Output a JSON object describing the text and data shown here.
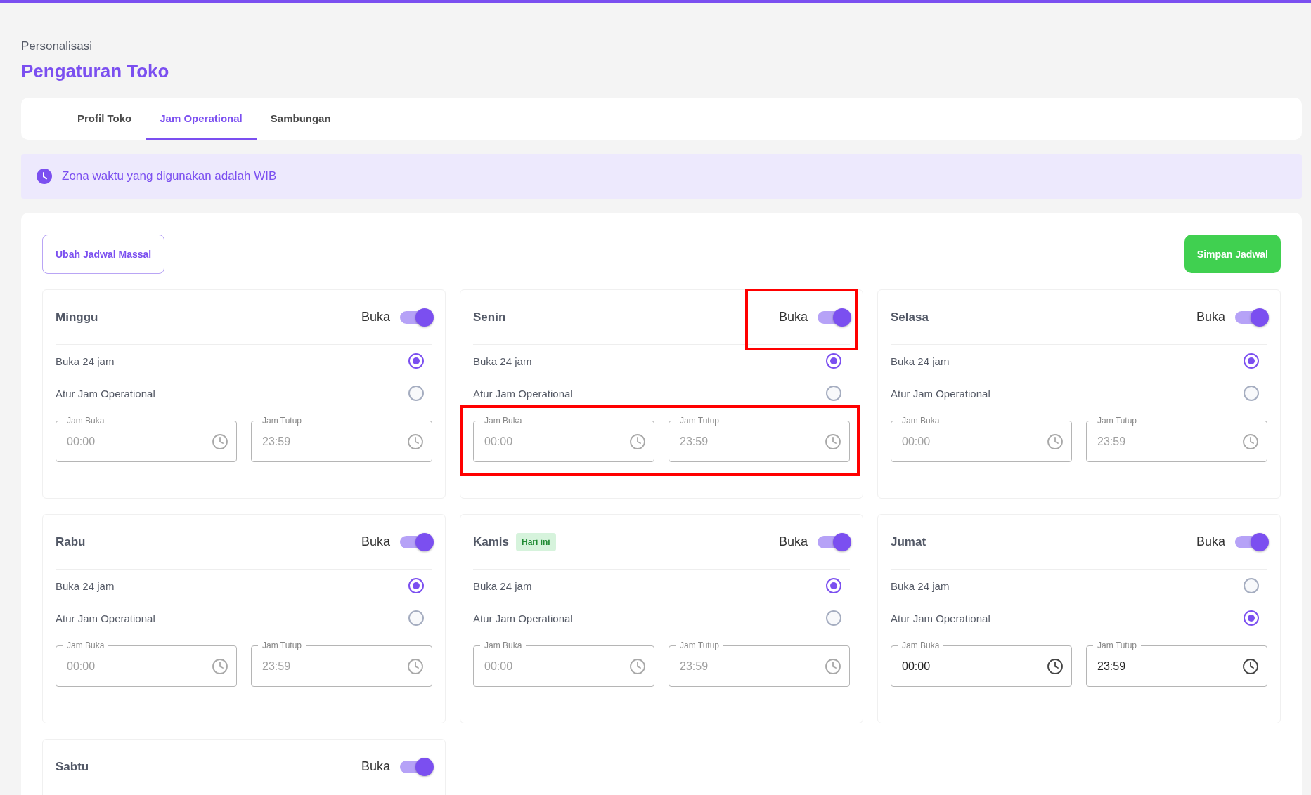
{
  "header": {
    "breadcrumb": "Personalisasi",
    "title": "Pengaturan Toko"
  },
  "tabs": [
    {
      "label": "Profil Toko",
      "selected": false
    },
    {
      "label": "Jam Operational",
      "selected": true
    },
    {
      "label": "Sambungan",
      "selected": false
    }
  ],
  "info_banner": {
    "text": "Zona waktu yang digunakan adalah WIB"
  },
  "actions": {
    "bulk_edit": "Ubah Jadwal Massal",
    "save": "Simpan Jadwal"
  },
  "days": [
    {
      "name": "Minggu",
      "toggle": {
        "label": "Buka",
        "on": true
      },
      "options": [
        {
          "label": "Buka 24 jam",
          "selected": true
        },
        {
          "label": "Atur Jam Operational",
          "selected": false
        }
      ],
      "fields": [
        {
          "label": "Jam Buka",
          "value": "00:00",
          "disabled": true
        },
        {
          "label": "Jam Tutup",
          "value": "23:59",
          "disabled": true
        }
      ]
    },
    {
      "name": "Senin",
      "toggle": {
        "label": "Buka",
        "on": true
      },
      "highlight_toggle": true,
      "highlight_fields": true,
      "options": [
        {
          "label": "Buka 24 jam",
          "selected": true
        },
        {
          "label": "Atur Jam Operational",
          "selected": false
        }
      ],
      "fields": [
        {
          "label": "Jam Buka",
          "value": "00:00",
          "disabled": true
        },
        {
          "label": "Jam Tutup",
          "value": "23:59",
          "disabled": true
        }
      ]
    },
    {
      "name": "Selasa",
      "toggle": {
        "label": "Buka",
        "on": true
      },
      "options": [
        {
          "label": "Buka 24 jam",
          "selected": true
        },
        {
          "label": "Atur Jam Operational",
          "selected": false
        }
      ],
      "fields": [
        {
          "label": "Jam Buka",
          "value": "00:00",
          "disabled": true
        },
        {
          "label": "Jam Tutup",
          "value": "23:59",
          "disabled": true
        }
      ]
    },
    {
      "name": "Rabu",
      "toggle": {
        "label": "Buka",
        "on": true
      },
      "options": [
        {
          "label": "Buka 24 jam",
          "selected": true
        },
        {
          "label": "Atur Jam Operational",
          "selected": false
        }
      ],
      "fields": [
        {
          "label": "Jam Buka",
          "value": "00:00",
          "disabled": true
        },
        {
          "label": "Jam Tutup",
          "value": "23:59",
          "disabled": true
        }
      ]
    },
    {
      "name": "Kamis",
      "badge": "Hari ini",
      "toggle": {
        "label": "Buka",
        "on": true
      },
      "options": [
        {
          "label": "Buka 24 jam",
          "selected": true
        },
        {
          "label": "Atur Jam Operational",
          "selected": false
        }
      ],
      "fields": [
        {
          "label": "Jam Buka",
          "value": "00:00",
          "disabled": true
        },
        {
          "label": "Jam Tutup",
          "value": "23:59",
          "disabled": true
        }
      ]
    },
    {
      "name": "Jumat",
      "toggle": {
        "label": "Buka",
        "on": true
      },
      "options": [
        {
          "label": "Buka 24 jam",
          "selected": false
        },
        {
          "label": "Atur Jam Operational",
          "selected": true
        }
      ],
      "fields": [
        {
          "label": "Jam Buka",
          "value": "00:00",
          "disabled": false
        },
        {
          "label": "Jam Tutup",
          "value": "23:59",
          "disabled": false
        }
      ]
    },
    {
      "name": "Sabtu",
      "toggle": {
        "label": "Buka",
        "on": true
      }
    }
  ]
}
